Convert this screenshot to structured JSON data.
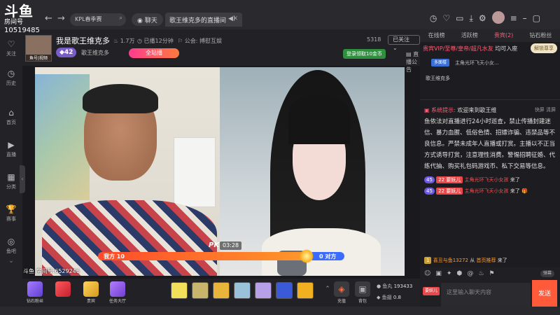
{
  "logo": {
    "big": "斗鱼",
    "sub": "房间号",
    "room_id": "10519485"
  },
  "topbar": {
    "search_text": "KPL春季赛",
    "chat_label": "聊天",
    "room_tab": "歌王维克多的直播间"
  },
  "sidebar": {
    "items": [
      {
        "label": "关注",
        "glyph": "♡"
      },
      {
        "label": "历史",
        "glyph": "◷"
      },
      {
        "label": "首页",
        "glyph": "⌂"
      },
      {
        "label": "直播",
        "glyph": "▶"
      },
      {
        "label": "分类",
        "glyph": "▦"
      },
      {
        "label": "赛事",
        "glyph": "🏆"
      },
      {
        "label": "鱼吧",
        "glyph": "◎"
      }
    ]
  },
  "room": {
    "host_badge": "鱼号|视频",
    "title": "我是歌王维克多",
    "heat": "1.7万",
    "duration": "已播12分钟",
    "notice_label": "公会: 搏慰互娱",
    "level": "42",
    "host_name": "歌王维克多",
    "all_station": "全站播",
    "follow_count": "5318",
    "follow_label": "已关注",
    "signin": "登录领取10金币",
    "announcement_btn": "直播公告"
  },
  "video": {
    "pk_label": "PK",
    "pk_time": "03:28",
    "our_side": "我方 10",
    "opp_side": "0 对方",
    "pk_ratio": 0.87,
    "watermark": "斗鱼 房间号:6529246"
  },
  "giftbar": {
    "left_items": [
      "钻石粉丝",
      "",
      "贵宾",
      "任务大厅"
    ],
    "charge": "充值",
    "bag": "背包",
    "fish_ball_label": "鱼丸",
    "fish_ball_value": "193433",
    "fish_wing_label": "鱼翅",
    "fish_wing_value": "0.8"
  },
  "rpanel": {
    "tabs": [
      "在线榜",
      "活跃榜",
      "贵宾(2)",
      "钻石粉丝"
    ],
    "vip_prefix": "贵宾VIP/",
    "vip_names": "至尊/皇帝/超凡水友",
    "vip_join": "均可入座",
    "unlock": "解锁尊享",
    "gz_tag": "多面楼",
    "gz_text": "主角光环飞天小女...",
    "announce": "歌王维克多",
    "sys_title": "系统提示:",
    "sys_welcome": "欢迎来到歌王维",
    "sys_ops": "快屏  清屏",
    "sys_body": "鱼依法对直播进行24小时巡查，禁止传播封建迷信、暴力血腥、低俗色情、招嫖诈骗、违禁品等不良信息。严禁未成年人直播或打赏。主播以不正当方式诱导打赏，注意理性消费。警惕招聘征婚、代练代抽、购买礼包码游戏币、私下交易等信息。",
    "msg1_lv": "45",
    "msg1_badge": "22 要妖儿",
    "msg1_name": "主角光环飞天小女孩",
    "msg1_action": "来了",
    "msg2_lv": "45",
    "msg2_badge": "22 要妖儿",
    "msg2_name": "主角光环飞天小女孩",
    "msg2_action": "来了",
    "msg3_lv": "1",
    "msg3_name": "喜丑与鱼13272",
    "msg3_mid": "从",
    "msg3_src": "首页推荐",
    "msg3_action": "来了",
    "danmu": "弹幕",
    "input_placeholder": "这里输入聊天内容",
    "fan_badge": "要妖儿",
    "send": "发送"
  }
}
